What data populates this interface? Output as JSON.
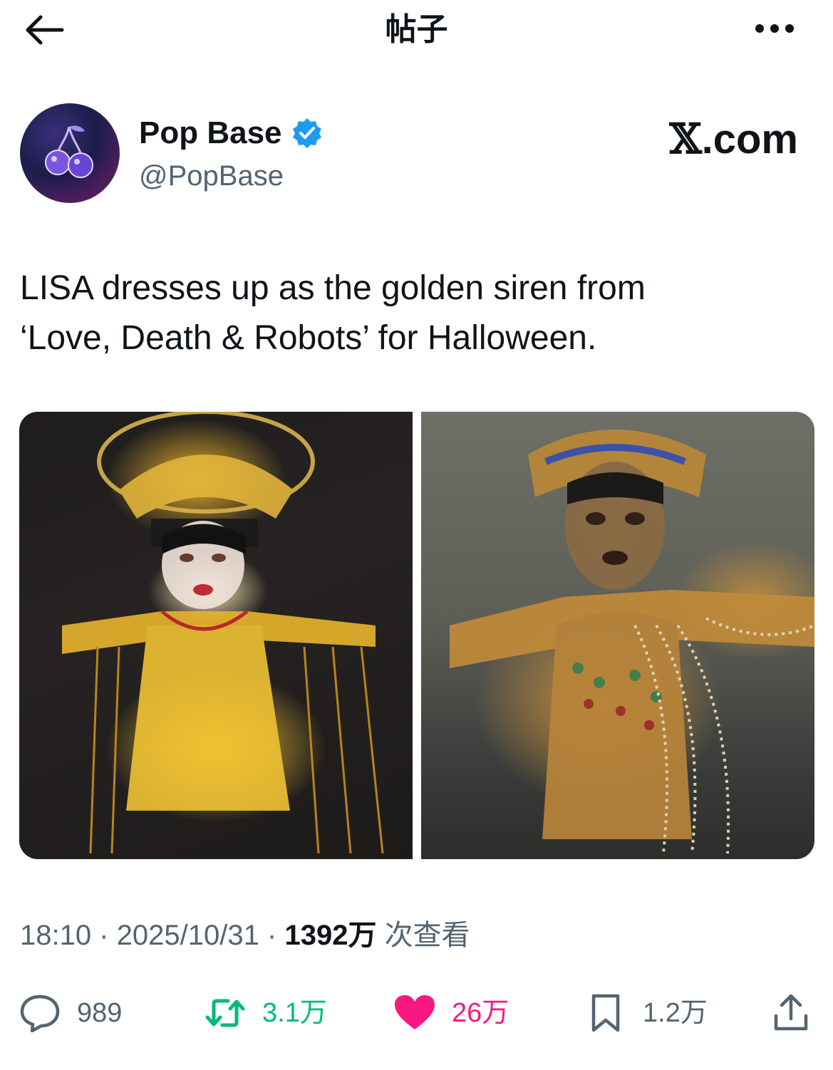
{
  "header": {
    "title": "帖子",
    "back_icon": "arrow-left-icon",
    "more_icon": "ellipsis-icon"
  },
  "author": {
    "display_name": "Pop Base",
    "handle": "@PopBase",
    "verified": true,
    "verified_color": "#1d9bf0",
    "avatar_icon": "cherry-icon"
  },
  "brand": {
    "x": "𝕏",
    "suffix": ".com"
  },
  "post": {
    "text_line1": "LISA dresses up as the golden siren from",
    "text_line2": "‘Love, Death & Robots’ for Halloween."
  },
  "media": [
    {
      "description_icon": "photo-lisa-costume"
    },
    {
      "description_icon": "photo-golden-siren"
    }
  ],
  "meta": {
    "time": "18:10",
    "date": "2025/10/31",
    "separator": "·",
    "views": "1392万",
    "views_suffix": "次查看"
  },
  "actions": {
    "replies": "989",
    "reposts": "3.1万",
    "likes": "26万",
    "bookmarks": "1.2万",
    "repost_color": "#00ba7c",
    "like_color": "#f91880",
    "muted_color": "#536471"
  }
}
